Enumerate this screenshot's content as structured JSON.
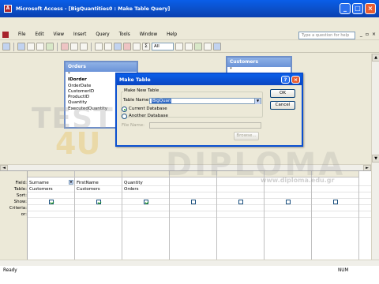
{
  "window": {
    "title": "Microsoft Access - [BigQuantities0 : Make Table Query]"
  },
  "menu": {
    "items": [
      "File",
      "Edit",
      "View",
      "Insert",
      "Query",
      "Tools",
      "Window",
      "Help"
    ],
    "help_placeholder": "Type a question for help"
  },
  "toolbar": {
    "zoom": "All",
    "qtype_badge": "Σ"
  },
  "tables": {
    "orders": {
      "title": "Orders",
      "fields": [
        "*",
        "IDorder",
        "OrderDate",
        "CustomerID",
        "ProductID",
        "Quantity",
        "ExecutedQuantity"
      ]
    },
    "customers": {
      "title": "Customers",
      "fields": [
        "*"
      ]
    }
  },
  "dialog": {
    "title": "Make Table",
    "section": "Make New Table",
    "table_name_label": "Table Name:",
    "table_name_value": "BigQuan",
    "current_db": "Current Database",
    "another_db": "Another Database",
    "file_name_label": "File Name:",
    "ok": "OK",
    "cancel": "Cancel",
    "browse": "Browse..."
  },
  "grid": {
    "row_labels": [
      "Field:",
      "Table:",
      "Sort:",
      "Show:",
      "Criteria:",
      "or:"
    ],
    "columns": [
      {
        "field": "Surname",
        "table": "Customers",
        "show": true
      },
      {
        "field": "FirstName",
        "table": "Customers",
        "show": true
      },
      {
        "field": "Quantity",
        "table": "Orders",
        "show": true
      },
      {
        "field": "",
        "table": "",
        "show": false
      },
      {
        "field": "",
        "table": "",
        "show": false
      },
      {
        "field": "",
        "table": "",
        "show": false
      },
      {
        "field": "",
        "table": "",
        "show": false
      }
    ]
  },
  "status": {
    "text": "Ready",
    "mode": "NUM"
  },
  "watermark": {
    "brand_main": "TEST",
    "brand_num": "4U",
    "diploma": "DIPLOMA",
    "url": "www.diploma.edu.gr"
  }
}
